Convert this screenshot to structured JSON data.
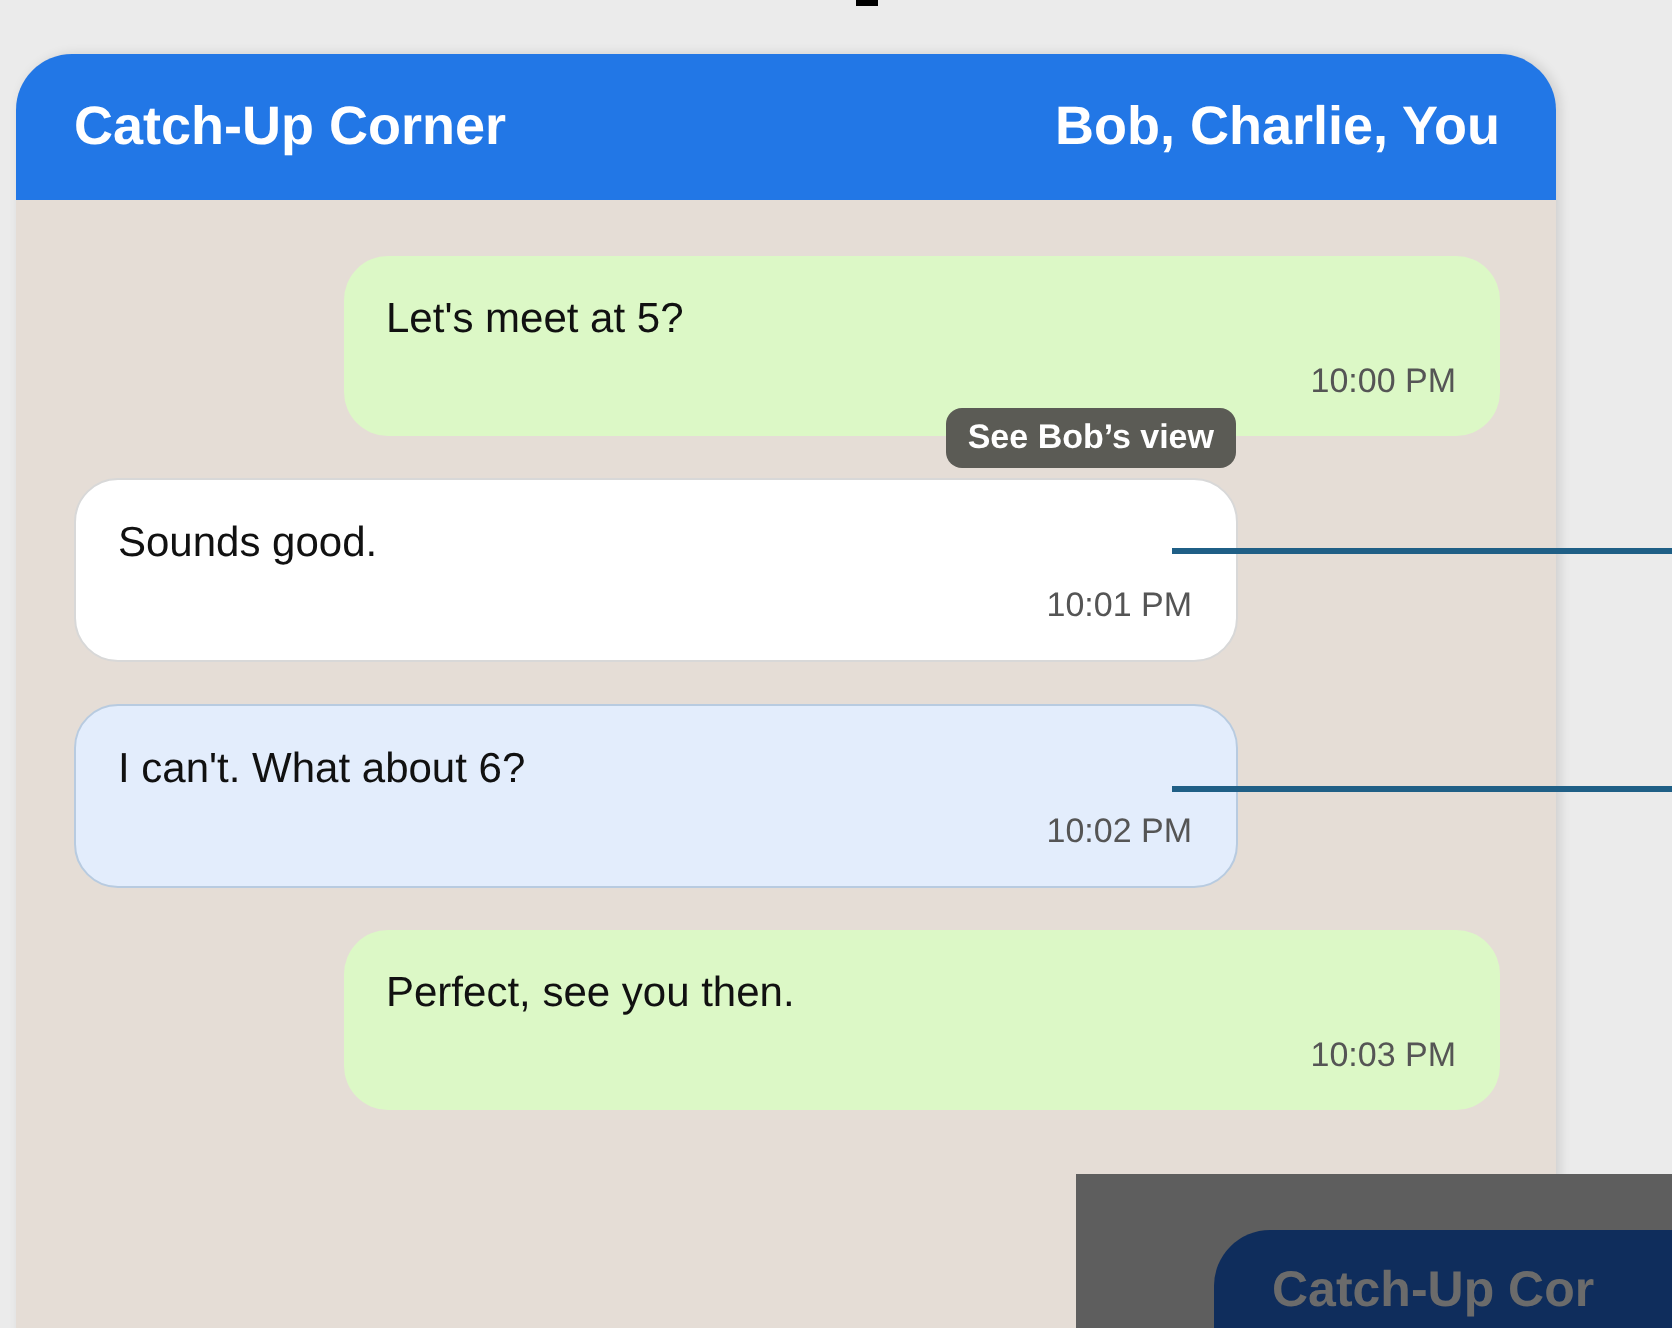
{
  "header": {
    "title": "Catch-Up Corner",
    "participants": "Bob, Charlie, You"
  },
  "messages": [
    {
      "kind": "sent",
      "text": "Let's meet at 5?",
      "time": "10:00 PM"
    },
    {
      "kind": "received",
      "text": "Sounds good.",
      "time": "10:01 PM",
      "tooltip": "See Bob’s view"
    },
    {
      "kind": "highlighted",
      "text": "I can't. What about 6?",
      "time": "10:02 PM"
    },
    {
      "kind": "sent",
      "text": "Perfect, see you then.",
      "time": "10:03 PM"
    }
  ],
  "overlay": {
    "title": "Catch-Up Cor"
  }
}
